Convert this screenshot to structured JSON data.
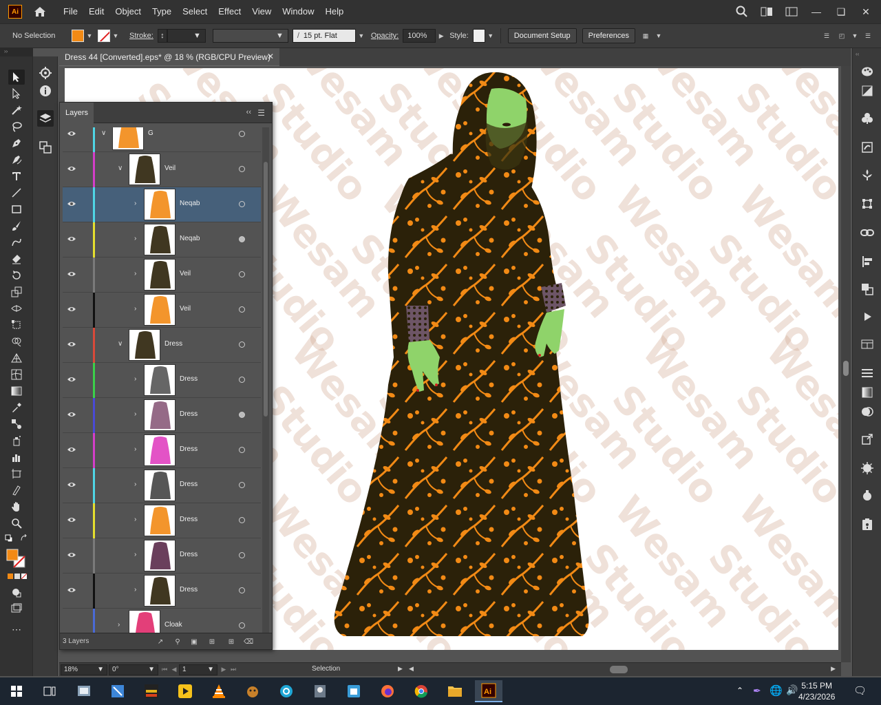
{
  "menubar": {
    "logo": "Ai",
    "items": [
      "File",
      "Edit",
      "Object",
      "Type",
      "Select",
      "Effect",
      "View",
      "Window",
      "Help"
    ]
  },
  "control": {
    "selection_label": "No Selection",
    "stroke_label": "Stroke:",
    "brush_value": "15 pt. Flat",
    "opacity_label": "Opacity:",
    "opacity_value": "100%",
    "style_label": "Style:",
    "document_setup": "Document Setup",
    "preferences": "Preferences"
  },
  "colors": {
    "fill": "#f28a15",
    "stroke_none_slash": "#e02020",
    "selected_row": "#46607a",
    "dress_dark": "#2b2109",
    "skin": "#8fd36a"
  },
  "document": {
    "tab_title": "Dress 44 [Converted].eps* @ 18 % (RGB/CPU Preview)"
  },
  "watermark": {
    "line1": "Wesam",
    "line2": "Studio"
  },
  "layers": {
    "title": "Layers",
    "count": "3 Layers",
    "rows": [
      {
        "name": "G",
        "color": "#4fd6e6",
        "indent": 0,
        "expanded": true,
        "target_filled": false
      },
      {
        "name": "Veil",
        "color": "#d43ec9",
        "indent": 1,
        "expanded": true,
        "target_filled": false
      },
      {
        "name": "Neqab",
        "color": "#4fd6e6",
        "indent": 2,
        "expanded": false,
        "target_filled": false,
        "selected": true
      },
      {
        "name": "Neqab",
        "color": "#e6df2e",
        "indent": 2,
        "expanded": false,
        "target_filled": true
      },
      {
        "name": "Veil",
        "color": "#7a7a7a",
        "indent": 2,
        "expanded": false,
        "target_filled": false
      },
      {
        "name": "Veil",
        "color": "#111111",
        "indent": 2,
        "expanded": false,
        "target_filled": false
      },
      {
        "name": "Dress",
        "color": "#d94a3a",
        "indent": 1,
        "expanded": true,
        "target_filled": false
      },
      {
        "name": "Dress",
        "color": "#3bd14a",
        "indent": 2,
        "expanded": false,
        "target_filled": false
      },
      {
        "name": "Dress",
        "color": "#4a4ad6",
        "indent": 2,
        "expanded": false,
        "target_filled": true
      },
      {
        "name": "Dress",
        "color": "#d43ec9",
        "indent": 2,
        "expanded": false,
        "target_filled": false
      },
      {
        "name": "Dress",
        "color": "#4fd6e6",
        "indent": 2,
        "expanded": false,
        "target_filled": false
      },
      {
        "name": "Dress",
        "color": "#e6df2e",
        "indent": 2,
        "expanded": false,
        "target_filled": false
      },
      {
        "name": "Dress",
        "color": "#7a7a7a",
        "indent": 2,
        "expanded": false,
        "target_filled": false
      },
      {
        "name": "Dress",
        "color": "#111111",
        "indent": 2,
        "expanded": false,
        "target_filled": false
      },
      {
        "name": "Cloak",
        "color": "#4a6ad6",
        "indent": 1,
        "expanded": false,
        "target_filled": false
      }
    ]
  },
  "status": {
    "zoom": "18%",
    "rotation": "0°",
    "artboard": "1",
    "tool": "Selection"
  },
  "taskbar": {
    "time": "5:15 PM",
    "date": "4/23/2026"
  }
}
